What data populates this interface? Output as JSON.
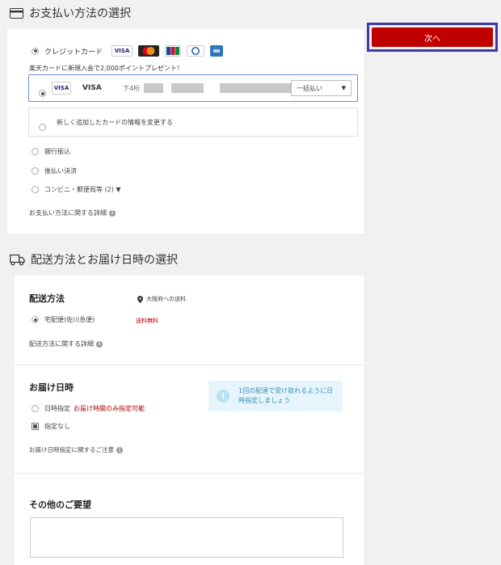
{
  "payment": {
    "title": "お支払い方法の選択",
    "credit_card_label": "クレジットカード",
    "card_brands": [
      "VISA",
      "MC",
      "JCB",
      "Diners",
      "AMEX"
    ],
    "promo": "楽天カードに新規入会で2,000ポイントプレゼント！",
    "saved_card": {
      "brand": "VISA",
      "name": "VISA",
      "last4_label": "下4桁",
      "installment": "一括払い"
    },
    "change_card": "新しく追加したカードの情報を変更する",
    "bank_transfer": "銀行振込",
    "deferred": "後払い決済",
    "convenience": "コンビニ・郵便局等 (2) ▼",
    "details_link": "お支払い方法に関する詳細"
  },
  "next_button": "次へ",
  "delivery": {
    "title": "配送方法とお届け日時の選択",
    "method_heading": "配送方法",
    "destination": "大阪府への送料",
    "method_option": "宅配便(佐川急便)",
    "shipping_fee": "送料無料",
    "method_details_link": "配送方法に関する詳細",
    "datetime_heading": "お届け日時",
    "date_specify": "日時指定",
    "date_specify_note": "お届け時間のみ指定可能",
    "no_specify": "指定なし",
    "tip": "1回の配達で受け取れるように日時指定しましょう",
    "datetime_notes_link": "お届け日時指定に関するご注意"
  },
  "other": {
    "heading": "その他のご要望",
    "value": ""
  },
  "colors": {
    "next_button": "#c00000",
    "next_outline": "#3a3aa8",
    "fee_text": "#b00000",
    "tip_bg": "#e6f5fb"
  }
}
